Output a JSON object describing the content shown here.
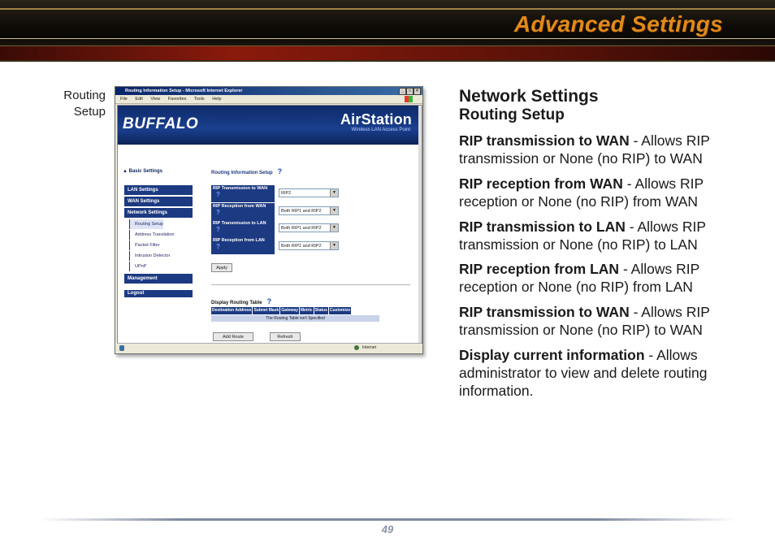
{
  "header": {
    "title": "Advanced Settings"
  },
  "side_label": {
    "line1": "Routing",
    "line2": "Setup"
  },
  "browser": {
    "window_title": "Routing Information Setup - Microsoft Internet Explorer",
    "menu": [
      "File",
      "Edit",
      "View",
      "Favorites",
      "Tools",
      "Help"
    ],
    "status_zone": "Internet",
    "brand_left": "BUFFALO",
    "brand_right": "AirStation",
    "brand_sub": "Wireless LAN Access Point",
    "basic_settings": "▲ Basic Settings",
    "nav": {
      "lan": "LAN Settings",
      "wan": "WAN Settings",
      "network": "Network Settings",
      "sub": [
        "Routing Setup",
        "Address Translation",
        "Packet Filter",
        "Intrusion Detector",
        "UPnP"
      ],
      "management": "Management",
      "logout": "Logout"
    },
    "routing_title": "Routing Information Setup",
    "help_mark": "?",
    "rip_rows": [
      {
        "label": "RIP Transmission to WAN",
        "value": "RIP2"
      },
      {
        "label": "RIP Reception from WAN",
        "value": "Both RIP1 and RIP2"
      },
      {
        "label": "RIP Transmission to LAN",
        "value": "Both RIP1 and RIP2"
      },
      {
        "label": "RIP Reception from LAN",
        "value": "Both RIP1 and RIP2"
      }
    ],
    "apply": "Apply",
    "display_title": "Display Routing Table",
    "table_headers": [
      "Destination Address",
      "Subnet Mask",
      "Gateway",
      "Metric",
      "Status",
      "Customize"
    ],
    "table_empty": "The Routing Table isn't Specified",
    "add_route": "Add Route",
    "refresh": "Refresh"
  },
  "content": {
    "heading": "Network Settings",
    "subheading": "Routing Setup",
    "items": [
      {
        "term": "RIP transmission to WAN",
        "desc": " - Allows RIP transmission or None (no RIP) to WAN"
      },
      {
        "term": "RIP reception from WAN",
        "desc": " - Allows RIP reception or None (no RIP) from WAN"
      },
      {
        "term": "RIP transmission to LAN",
        "desc": " - Allows RIP transmission or None (no RIP) to LAN"
      },
      {
        "term": "RIP reception from LAN",
        "desc": " - Allows RIP reception or None (no RIP) from LAN"
      },
      {
        "term": "RIP transmission to WAN",
        "desc": " - Allows RIP transmission or None (no RIP) to WAN"
      },
      {
        "term": "Display current information",
        "desc": " - Allows administrator to view and delete routing information."
      }
    ]
  },
  "footer": {
    "page_number": "49"
  },
  "colors": {
    "title": "#e08a1a",
    "nav": "#1c3a82",
    "banner": "#1a3f8e"
  }
}
